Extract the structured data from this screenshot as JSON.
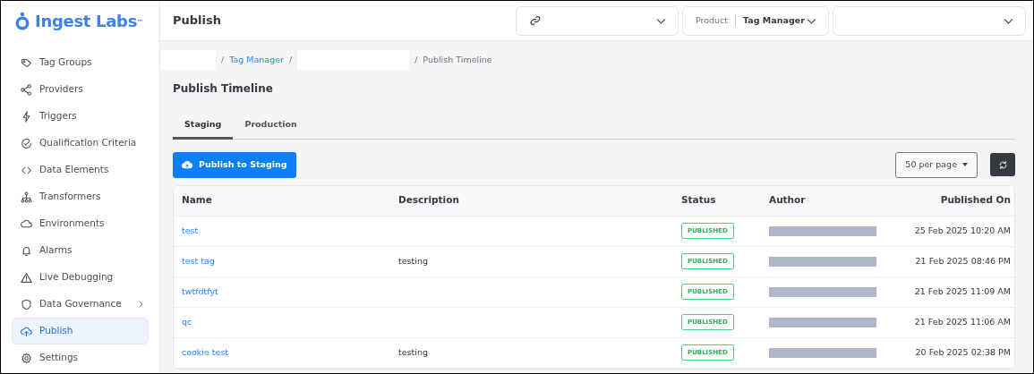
{
  "brand": {
    "name": "Ingest Labs$^{™}$"
  },
  "sidebar": {
    "items": [
      {
        "label": "Tag Groups",
        "selected": false,
        "expandable": false
      },
      {
        "label": "Providers",
        "selected": false,
        "expandable": false
      },
      {
        "label": "Triggers",
        "selected": false,
        "expandable": false
      },
      {
        "label": "Qualification Criteria",
        "selected": false,
        "expandable": false
      },
      {
        "label": "Data Elements",
        "selected": false,
        "expandable": false
      },
      {
        "label": "Transformers",
        "selected": false,
        "expandable": false
      },
      {
        "label": "Environments",
        "selected": false,
        "expandable": false
      },
      {
        "label": "Alarms",
        "selected": false,
        "expandable": false
      },
      {
        "label": "Live Debugging",
        "selected": false,
        "expandable": false
      },
      {
        "label": "Data Governance",
        "selected": false,
        "expandable": true
      },
      {
        "label": "Publish",
        "selected": true,
        "expandable": false
      },
      {
        "label": "Settings",
        "selected": false,
        "expandable": false
      }
    ]
  },
  "header": {
    "title": "Publish",
    "selectors": [
      {
        "kind": "link"
      },
      {
        "kind": "labeled",
        "label": "Product",
        "value": "Tag Manager"
      },
      {
        "kind": "empty"
      }
    ]
  },
  "breadcrumb": [
    {
      "kind": "redacted"
    },
    {
      "kind": "link",
      "separator": "/",
      "text": "Tag Manager"
    },
    {
      "kind": "redacted",
      "separator": "/"
    },
    {
      "kind": "current",
      "separator": "/",
      "text": "Publish Timeline"
    }
  ],
  "page_title": "Publish Timeline",
  "tabs": [
    {
      "label": "Staging",
      "selected": true
    },
    {
      "label": "Production",
      "selected": false
    }
  ],
  "publish_button": "Publish to Staging",
  "page_size": "50 per page",
  "table": {
    "columns": [
      "Name",
      "Description",
      "Status",
      "Author",
      "Published On"
    ],
    "rows": [
      {
        "name": "test",
        "status": "PUBLISHED",
        "published_on": "25 Feb 2025 10:20 AM"
      },
      {
        "name": "test tag",
        "description": "testing",
        "status": "PUBLISHED",
        "published_on": "21 Feb 2025 08:46 PM"
      },
      {
        "name": "twtfdtfyt",
        "status": "PUBLISHED",
        "published_on": "21 Feb 2025 11:09 AM"
      },
      {
        "name": "qc",
        "status": "PUBLISHED",
        "published_on": "21 Feb 2025 11:06 AM"
      },
      {
        "name": "cookie test",
        "description": "testing",
        "status": "PUBLISHED",
        "published_on": "20 Feb 2025 02:38 PM"
      }
    ]
  }
}
